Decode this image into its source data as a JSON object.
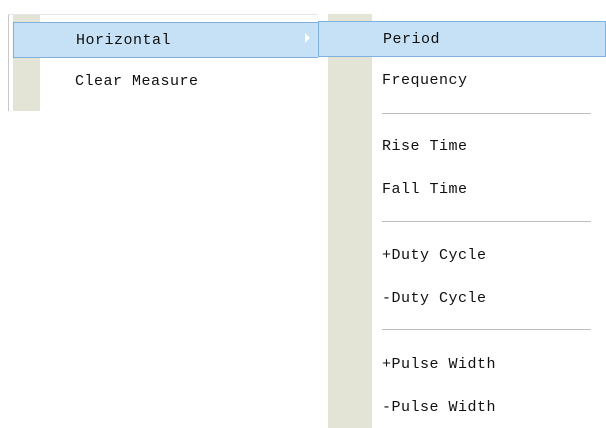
{
  "primary_menu": {
    "items": [
      {
        "label": "Horizontal",
        "selected": true,
        "has_submenu": true
      },
      {
        "label": "Clear Measure",
        "selected": false,
        "has_submenu": false
      }
    ]
  },
  "submenu": {
    "items": [
      {
        "label": "Period",
        "selected": true
      },
      {
        "label": "Frequency"
      },
      {
        "label": "Rise Time"
      },
      {
        "label": "Fall Time"
      },
      {
        "label": "+Duty Cycle"
      },
      {
        "label": "-Duty Cycle"
      },
      {
        "label": "+Pulse Width"
      },
      {
        "label": "-Pulse Width"
      }
    ]
  },
  "colors": {
    "highlight_fill": "#c6e0f5",
    "highlight_border": "#7fb0de",
    "gutter": "#e3e3d6",
    "separator": "#bdbdbd",
    "text": "#101010"
  },
  "icons": {
    "submenu_arrow": "triangle-right-icon"
  }
}
